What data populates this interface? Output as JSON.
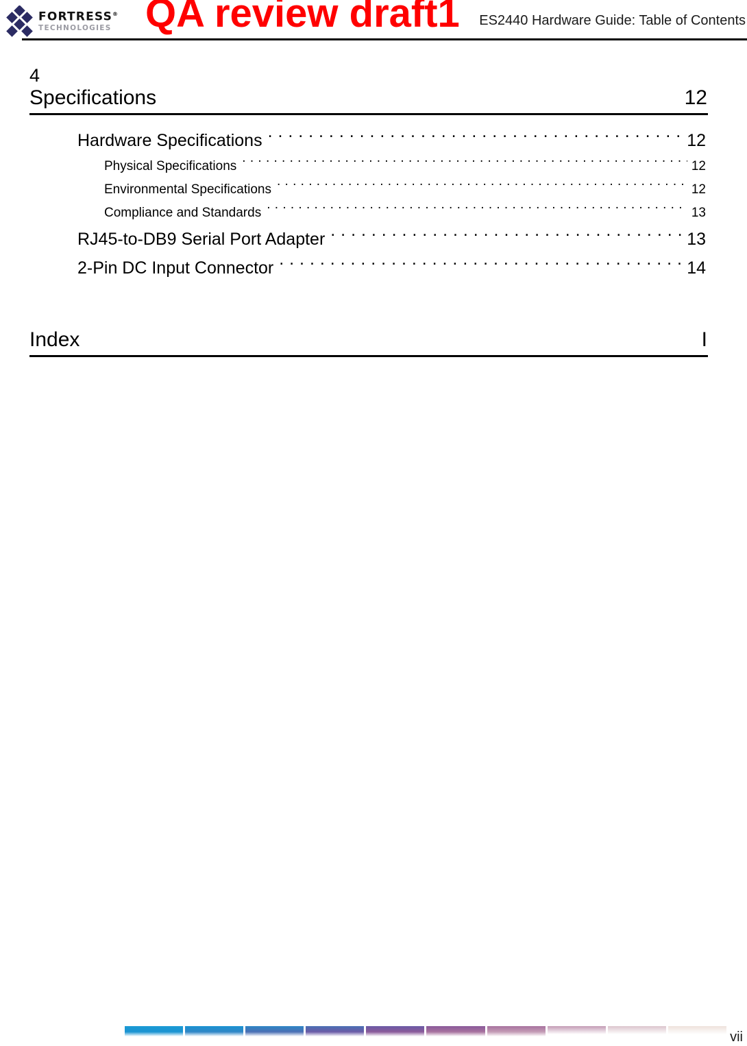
{
  "header": {
    "logo": {
      "icon": "fortress-diamond-logo",
      "brand": "FORTRESS",
      "registered_mark": "®",
      "tagline": "TECHNOLOGIES"
    },
    "title": "ES2440 Hardware Guide: Table of Contents"
  },
  "watermark": {
    "text": "QA review draft1",
    "color": "#ff0000"
  },
  "toc": {
    "chapter": {
      "number": "4",
      "title": "Specifications",
      "page": "12"
    },
    "entries": [
      {
        "level": 1,
        "title": "Hardware Specifications",
        "page": "12"
      },
      {
        "level": 2,
        "title": "Physical Specifications",
        "page": "12"
      },
      {
        "level": 2,
        "title": "Environmental Specifications",
        "page": "12"
      },
      {
        "level": 2,
        "title": "Compliance and Standards",
        "page": "13"
      },
      {
        "level": 1,
        "title": "RJ45-to-DB9 Serial Port Adapter",
        "page": "13"
      },
      {
        "level": 1,
        "title": "2-Pin DC Input Connector",
        "page": "14"
      }
    ],
    "index": {
      "title": "Index",
      "page": "I"
    }
  },
  "footer": {
    "page_number": "vii",
    "bar_colors": [
      "#1b9ad4",
      "#1a93d2",
      "#2f86c6",
      "#4a6fb4",
      "#6a5ba6",
      "#8a5a9a",
      "#a7719e",
      "#c39bb5",
      "#dcc5cd",
      "#eee2dc"
    ]
  }
}
